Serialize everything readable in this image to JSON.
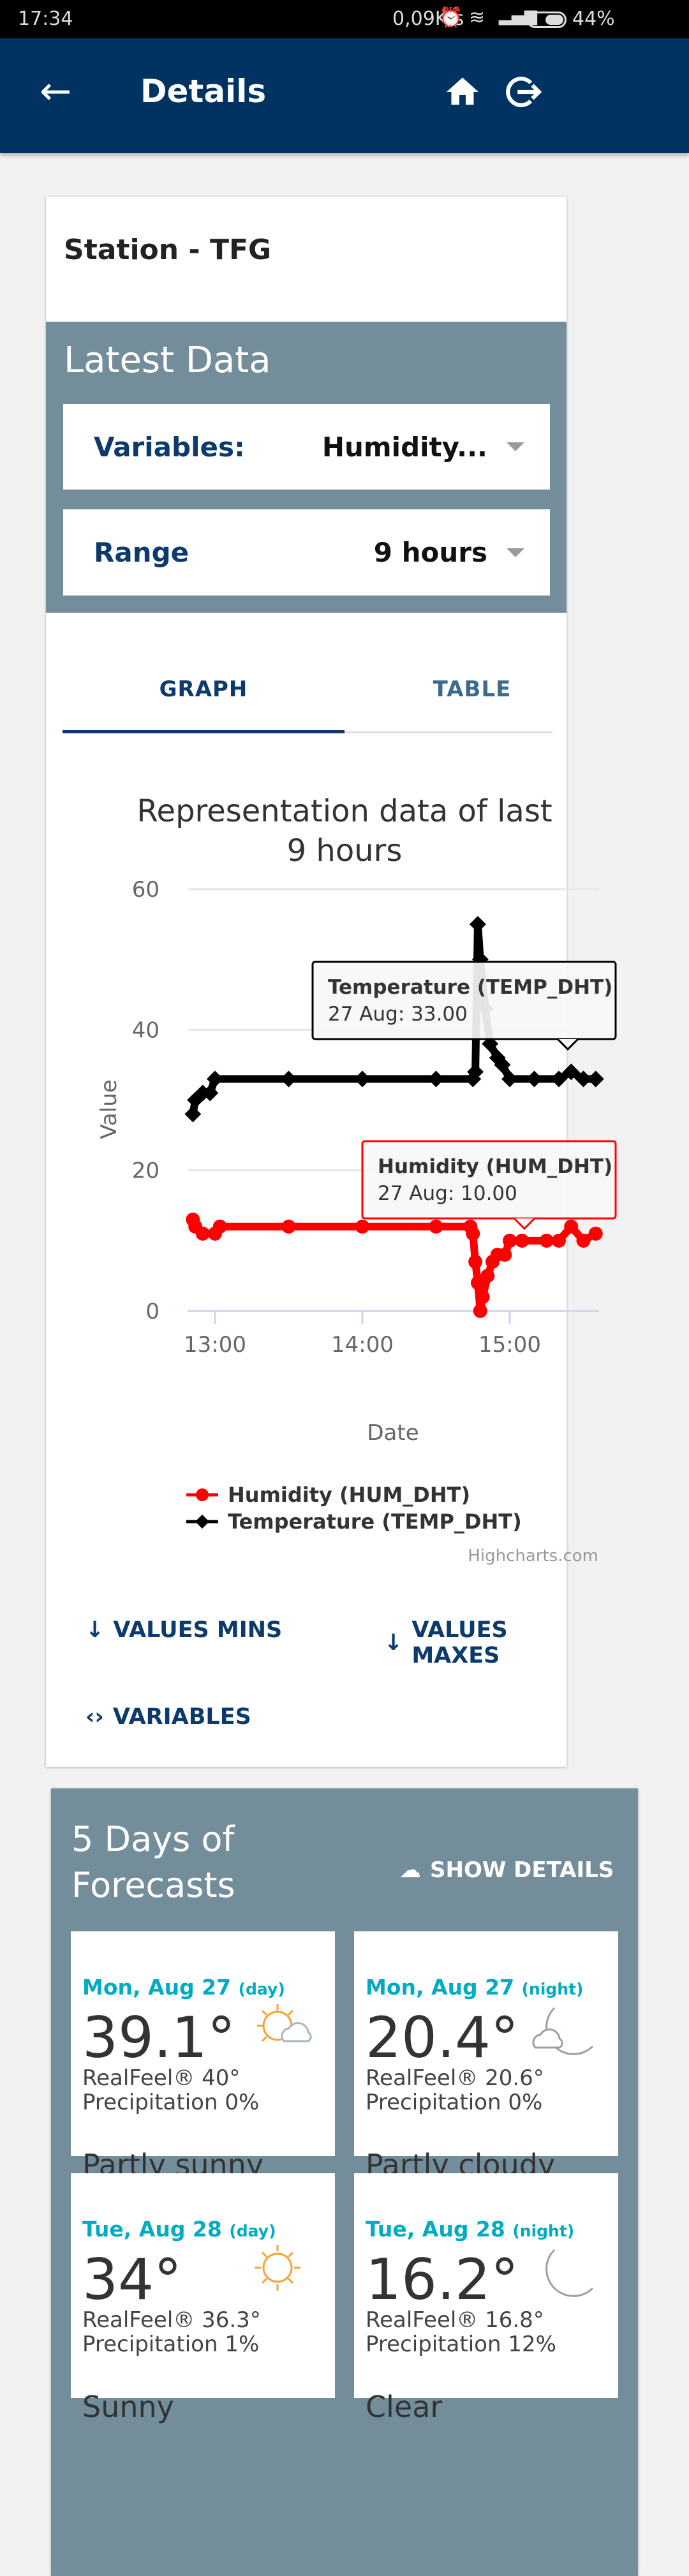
{
  "status_bar": {
    "time": "17:34",
    "speed": "0,09K/s",
    "battery": "44%"
  },
  "app_bar": {
    "title": "Details"
  },
  "station": {
    "title": "Station - TFG"
  },
  "latest": {
    "title": "Latest Data",
    "variables_label": "Variables:",
    "variables_value": "Humidity...",
    "range_label": "Range",
    "range_value": "9 hours"
  },
  "tabs": [
    {
      "label": "GRAPH",
      "active": true
    },
    {
      "label": "TABLE",
      "active": false
    }
  ],
  "chart_data": {
    "type": "line",
    "title_line1": "Representation data of last",
    "title_line2": "9 hours",
    "xlabel": "Date",
    "ylabel": "Value",
    "yticks": [
      "60",
      "40",
      "20",
      "0"
    ],
    "ylim": [
      0,
      60
    ],
    "xticks": [
      "13:00",
      "14:00",
      "15:00"
    ],
    "credit": "Highcharts.com",
    "series": [
      {
        "name": "Humidity (HUM_DHT)",
        "color": "#ff0000",
        "marker": "circle",
        "points": [
          [
            "12:51",
            13
          ],
          [
            "12:52",
            12
          ],
          [
            "12:55",
            11
          ],
          [
            "13:00",
            11
          ],
          [
            "13:02",
            12
          ],
          [
            "13:30",
            12
          ],
          [
            "14:00",
            12
          ],
          [
            "14:30",
            12
          ],
          [
            "14:44",
            12
          ],
          [
            "14:45",
            11
          ],
          [
            "14:46",
            7
          ],
          [
            "14:47",
            4
          ],
          [
            "14:48",
            0
          ],
          [
            "14:49",
            2
          ],
          [
            "14:51",
            5
          ],
          [
            "14:53",
            7
          ],
          [
            "14:55",
            8
          ],
          [
            "14:58",
            8
          ],
          [
            "15:00",
            10
          ],
          [
            "15:05",
            10
          ],
          [
            "15:15",
            10
          ],
          [
            "15:20",
            10
          ],
          [
            "15:25",
            12
          ],
          [
            "15:30",
            10
          ],
          [
            "15:35",
            11
          ]
        ]
      },
      {
        "name": "Temperature (TEMP_DHT)",
        "color": "#000000",
        "marker": "diamond",
        "points": [
          [
            "12:51",
            28
          ],
          [
            "12:52",
            30
          ],
          [
            "12:55",
            31
          ],
          [
            "12:58",
            31
          ],
          [
            "13:00",
            33
          ],
          [
            "13:30",
            33
          ],
          [
            "14:00",
            33
          ],
          [
            "14:30",
            33
          ],
          [
            "14:45",
            33
          ],
          [
            "14:46",
            34
          ],
          [
            "14:47",
            55
          ],
          [
            "14:48",
            50
          ],
          [
            "14:50",
            43
          ],
          [
            "14:52",
            38
          ],
          [
            "14:55",
            36
          ],
          [
            "14:57",
            35
          ],
          [
            "15:00",
            33
          ],
          [
            "15:10",
            33
          ],
          [
            "15:20",
            33
          ],
          [
            "15:25",
            34
          ],
          [
            "15:30",
            33
          ],
          [
            "15:35",
            33
          ]
        ]
      }
    ],
    "tooltips": [
      {
        "series": "Temperature (TEMP_DHT)",
        "text": "27 Aug: 33.00",
        "border": "#000000"
      },
      {
        "series": "Humidity (HUM_DHT)",
        "text": "27 Aug: 10.00",
        "border": "#ff0000"
      }
    ]
  },
  "actions": {
    "mins": "VALUES MINS",
    "maxes": "VALUES MAXES",
    "variables": "VARIABLES"
  },
  "forecast": {
    "title_line1": "5 Days of",
    "title_line2": "Forecasts",
    "show_details": "SHOW DETAILS",
    "tiles": [
      {
        "date": "Mon, Aug 27",
        "period": "(day)",
        "temp": "39.1°",
        "realfeel": "RealFeel® 40°",
        "precip": "Precipitation 0%",
        "desc": "Partly sunny",
        "icon": "partly-sunny-icon"
      },
      {
        "date": "Mon, Aug 27",
        "period": "(night)",
        "temp": "20.4°",
        "realfeel": "RealFeel® 20.6°",
        "precip": "Precipitation 0%",
        "desc": "Partly cloudy",
        "icon": "partly-cloudy-night-icon"
      },
      {
        "date": "Tue, Aug 28",
        "period": "(day)",
        "temp": "34°",
        "realfeel": "RealFeel® 36.3°",
        "precip": "Precipitation 1%",
        "desc": "Sunny",
        "icon": "sun-icon"
      },
      {
        "date": "Tue, Aug 28",
        "period": "(night)",
        "temp": "16.2°",
        "realfeel": "RealFeel® 16.8°",
        "precip": "Precipitation 12%",
        "desc": "Clear",
        "icon": "moon-icon"
      }
    ]
  },
  "colors": {
    "app_bar": "#003361",
    "panel": "#748d9a",
    "accent": "#0b3a6b",
    "forecast_date": "#00acc1"
  }
}
